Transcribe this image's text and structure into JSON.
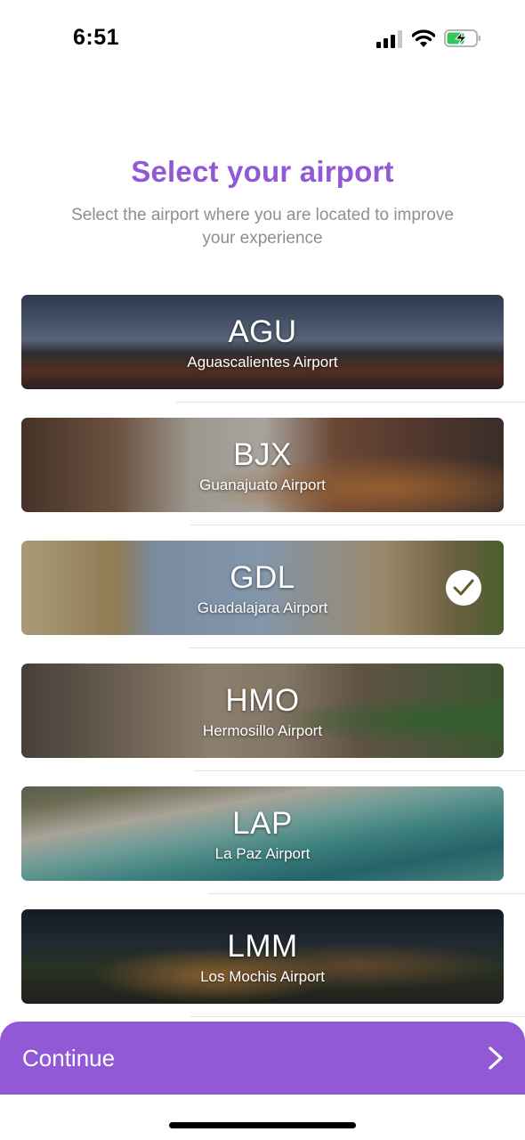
{
  "status_bar": {
    "time": "6:51"
  },
  "header": {
    "title": "Select your airport",
    "subtitle": "Select the airport where you are located to improve your experience"
  },
  "airports": [
    {
      "code": "AGU",
      "name": "Aguascalientes Airport",
      "selected": false
    },
    {
      "code": "BJX",
      "name": "Guanajuato Airport",
      "selected": false
    },
    {
      "code": "GDL",
      "name": "Guadalajara Airport",
      "selected": true
    },
    {
      "code": "HMO",
      "name": "Hermosillo Airport",
      "selected": false
    },
    {
      "code": "LAP",
      "name": "La Paz Airport",
      "selected": false
    },
    {
      "code": "LMM",
      "name": "Los Mochis Airport",
      "selected": false
    }
  ],
  "footer": {
    "continue_label": "Continue"
  },
  "colors": {
    "accent": "#9159d6",
    "subtitle": "#8e8e93",
    "battery_fill": "#34c759"
  },
  "icons": {
    "signal": "signal-icon",
    "wifi": "wifi-icon",
    "battery": "battery-charging-icon",
    "check": "check-icon",
    "chevron": "chevron-right-icon"
  }
}
